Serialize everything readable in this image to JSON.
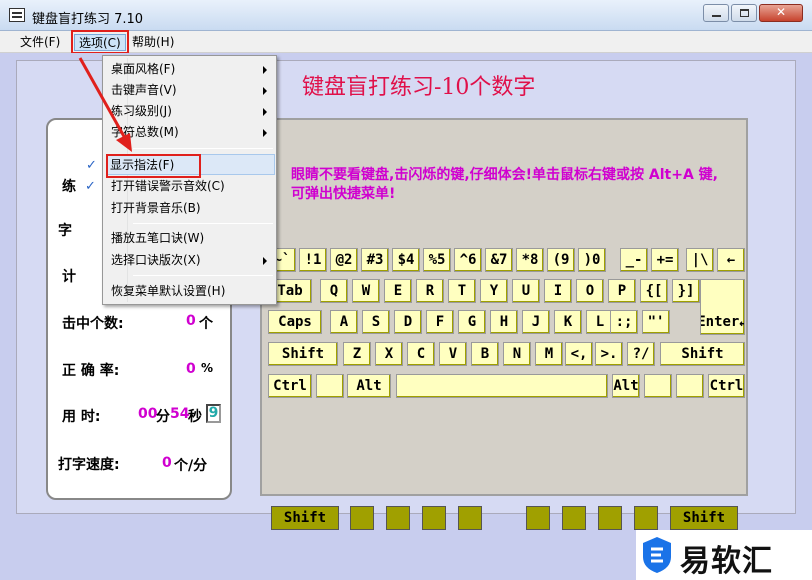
{
  "window": {
    "title": "键盘盲打练习 7.10"
  },
  "menubar": {
    "file": "文件(F)",
    "options": "选项(C)",
    "help": "帮助(H)"
  },
  "options_menu": {
    "items": [
      {
        "label": "桌面风格(F)",
        "submenu": true,
        "checked": false
      },
      {
        "label": "击键声音(V)",
        "submenu": true,
        "checked": false
      },
      {
        "label": "练习级别(J)",
        "submenu": true,
        "checked": false
      },
      {
        "label": "字符总数(M)",
        "submenu": true,
        "checked": false
      },
      {
        "label": "显示指法(F)",
        "submenu": false,
        "checked": true
      },
      {
        "label": "打开错误警示音效(C)",
        "submenu": false,
        "checked": true
      },
      {
        "label": "打开背景音乐(B)",
        "submenu": false,
        "checked": false
      },
      {
        "label": "播放五笔口诀(W)",
        "submenu": false,
        "checked": false
      },
      {
        "label": "选择口诀版次(X)",
        "submenu": true,
        "checked": false
      },
      {
        "label": "恢复菜单默认设置(H)",
        "submenu": false,
        "checked": false
      }
    ],
    "check_glyph": "✓"
  },
  "main": {
    "title": "键盘盲打练习-10个数字",
    "hint": "眼睛不要看键盘,击闪烁的键,仔细体会!单击鼠标右键或按 Alt+A 键,可弹出快捷菜单!"
  },
  "stats": {
    "partial_labels": [
      "练",
      "字",
      "计"
    ],
    "hits_label": "击中个数:",
    "hits_value": "0",
    "hits_unit": "个",
    "accuracy_label": "正 确 率:",
    "accuracy_value": "0",
    "accuracy_unit": "%",
    "time_label": "用  时:",
    "minutes": "00",
    "min_unit": "分",
    "seconds": "54",
    "sec_unit": "秒",
    "time_box": "9",
    "speed_label": "打字速度:",
    "speed_value": "0",
    "speed_unit": "个/分"
  },
  "keyboard": {
    "row1": [
      "~`",
      "!1",
      "@2",
      "#3",
      "$4",
      "%5",
      "^6",
      "&7",
      "*8",
      "(9",
      ")0",
      "_-",
      "+=",
      "|\\",
      "←"
    ],
    "row2": [
      "Tab",
      "Q",
      "W",
      "E",
      "R",
      "T",
      "Y",
      "U",
      "I",
      "O",
      "P",
      "{[",
      "}]"
    ],
    "row3": [
      "Caps",
      "A",
      "S",
      "D",
      "F",
      "G",
      "H",
      "J",
      "K",
      "L",
      ":;",
      "\"'",
      "Enter↵"
    ],
    "row4": [
      "Shift",
      "Z",
      "X",
      "C",
      "V",
      "B",
      "N",
      "M",
      "<,",
      ">.",
      "?/",
      "Shift"
    ],
    "row5": [
      "Ctrl",
      "",
      "Alt",
      "",
      "Alt",
      "",
      "",
      "Ctrl"
    ],
    "footer": [
      "Shift",
      "",
      "",
      "",
      "",
      "",
      "",
      "",
      "",
      "Shift"
    ]
  },
  "colors": {
    "accent_pink": "#d000d0",
    "title_red": "#e0104a",
    "key_fill": "#ffffc0",
    "highlight_red": "#e0201c",
    "client_bg": "#c8cdee"
  },
  "watermark": {
    "text": "易软汇",
    "logo": "shield-logo"
  }
}
